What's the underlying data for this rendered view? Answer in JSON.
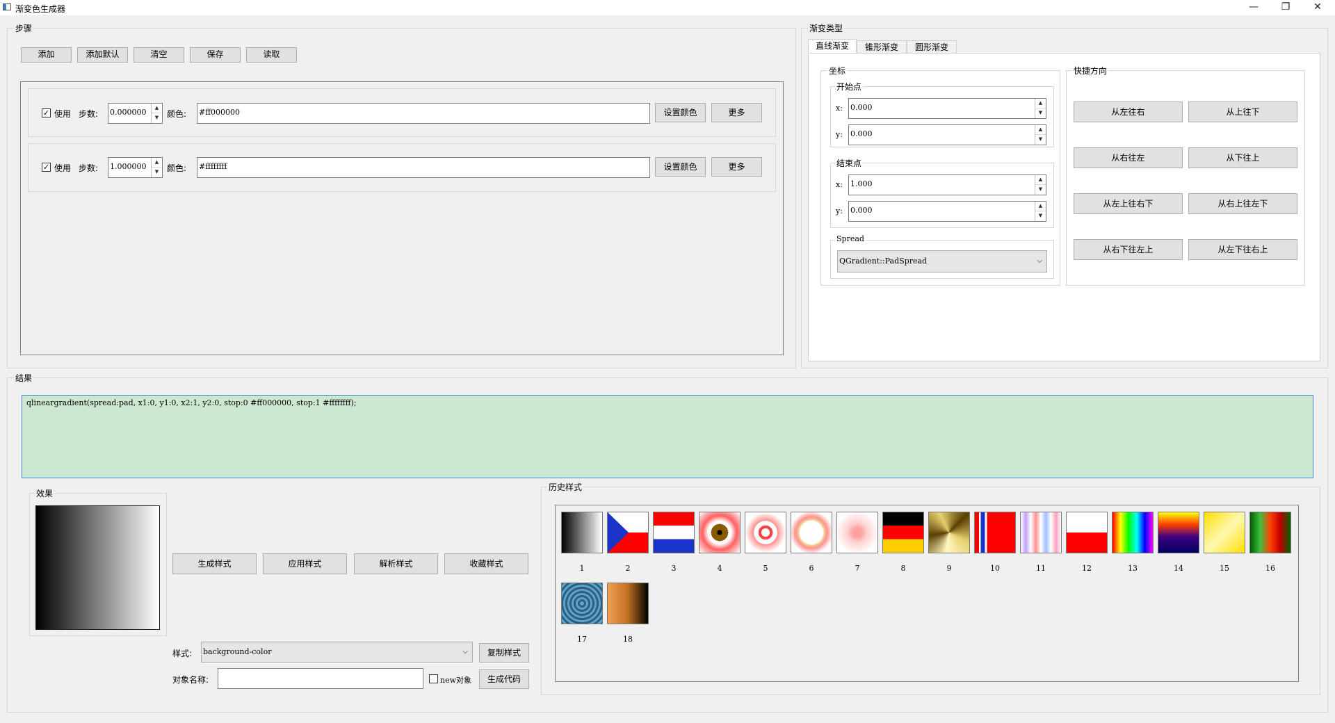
{
  "window": {
    "title": "渐变色生成器",
    "min": "—",
    "restore": "❐",
    "close": "✕"
  },
  "steps": {
    "title": "步骤",
    "buttons": {
      "add": "添加",
      "add_default": "添加默认",
      "clear": "清空",
      "save": "保存",
      "load": "读取"
    },
    "rows": [
      {
        "use_label": "使用",
        "checked": true,
        "step_label": "步数:",
        "step": "0.000000",
        "color_label": "颜色:",
        "color": "#ff000000",
        "set_color": "设置颜色",
        "more": "更多"
      },
      {
        "use_label": "使用",
        "checked": true,
        "step_label": "步数:",
        "step": "1.000000",
        "color_label": "颜色:",
        "color": "#ffffffff",
        "set_color": "设置颜色",
        "more": "更多"
      }
    ]
  },
  "gradient_type": {
    "title": "渐变类型",
    "tabs": [
      "直线渐变",
      "锥形渐变",
      "圆形渐变"
    ],
    "coords_title": "坐标",
    "start_title": "开始点",
    "end_title": "结束点",
    "x_label": "x:",
    "y_label": "y:",
    "start": {
      "x": "0.000",
      "y": "0.000"
    },
    "end": {
      "x": "1.000",
      "y": "0.000"
    },
    "spread_title": "Spread",
    "spread_value": "QGradient::PadSpread",
    "quick_title": "快捷方向",
    "quick": [
      "从左往右",
      "从上往下",
      "从右往左",
      "从下往上",
      "从左上往右下",
      "从右上往左下",
      "从右下往左上",
      "从左下往右上"
    ]
  },
  "result": {
    "title": "结果",
    "code": "qlineargradient(spread:pad, x1:0, y1:0, x2:1, y2:0, stop:0 #ff000000, stop:1 #ffffffff);",
    "effect_title": "效果",
    "buttons": {
      "generate": "生成样式",
      "apply": "应用样式",
      "parse": "解析样式",
      "favorite": "收藏样式"
    },
    "style_label": "样式:",
    "style_value": "background-color",
    "copy_style": "复制样式",
    "object_label": "对象名称:",
    "object_value": "",
    "new_object_label": "new对象",
    "generate_code": "生成代码"
  },
  "history": {
    "title": "历史样式",
    "items": [
      "1",
      "2",
      "3",
      "4",
      "5",
      "6",
      "7",
      "8",
      "9",
      "10",
      "11",
      "12",
      "13",
      "14",
      "15",
      "16",
      "17",
      "18"
    ]
  },
  "colors": {
    "result_bg": "#cce8d0",
    "result_border": "#3d7fd0"
  }
}
